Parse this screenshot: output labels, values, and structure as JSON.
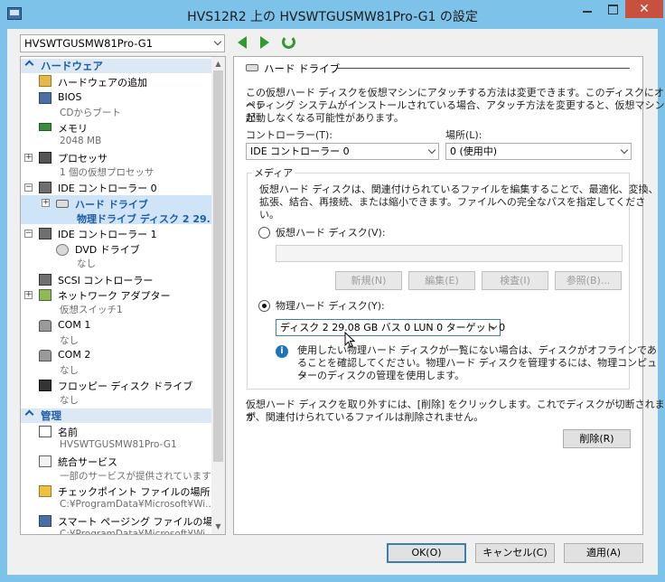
{
  "window": {
    "title": "HVS12R2 上の HVSWTGUSMW81Pro-G1 の設定",
    "close_glyph": "✕"
  },
  "vm_selector": {
    "value": "HVSWTGUSMW81Pro-G1"
  },
  "tree": {
    "hardware_header": "ハードウェア",
    "management_header": "管理",
    "items": {
      "add_hardware": "ハードウェアの追加",
      "bios": {
        "label": "BIOS",
        "sub": "CDからブート"
      },
      "memory": {
        "label": "メモリ",
        "sub": "2048 MB"
      },
      "processor": {
        "label": "プロセッサ",
        "sub": "1 個の仮想プロセッサ"
      },
      "ide0": "IDE コントローラー 0",
      "hard_drive": {
        "label": "ハード ドライブ",
        "sub": "物理ドライブ ディスク 2 29..."
      },
      "ide1": "IDE コントローラー 1",
      "dvd": {
        "label": "DVD ドライブ",
        "sub": "なし"
      },
      "scsi": "SCSI コントローラー",
      "network": {
        "label": "ネットワーク アダプター",
        "sub": "仮想スイッチ1"
      },
      "com1": {
        "label": "COM 1",
        "sub": "なし"
      },
      "com2": {
        "label": "COM 2",
        "sub": "なし"
      },
      "floppy": {
        "label": "フロッピー ディスク ドライブ",
        "sub": "なし"
      },
      "name": {
        "label": "名前",
        "sub": "HVSWTGUSMW81Pro-G1"
      },
      "integration": {
        "label": "統合サービス",
        "sub": "一部のサービスが提供されています"
      },
      "checkpoint": {
        "label": "チェックポイント ファイルの場所",
        "sub": "C:¥ProgramData¥Microsoft¥Wi..."
      },
      "paging": {
        "label": "スマート ページング ファイルの場所",
        "sub": "C:¥ProgramData¥Microsoft¥Wi..."
      }
    }
  },
  "detail": {
    "section_title": "ハード ドライブ",
    "intro_lines": [
      "この仮想ハード ディスクを仮想マシンにアタッチする方法は変更できます。このディスクにオペレ",
      "ーティング システムがインストールされている場合、アタッチ方法を変更すると、仮想マシンが",
      "起動しなくなる可能性があります。"
    ],
    "controller_label": "コントローラー(T):",
    "controller_value": "IDE コントローラー 0",
    "location_label": "場所(L):",
    "location_value": "0 (使用中)",
    "media_label": "メディア",
    "media_desc_lines": [
      "仮想ハード ディスクは、関連付けられているファイルを編集することで、最適化、変換、",
      "拡張、結合、再接続、または縮小できます。ファイルへの完全なパスを指定してくださ",
      "い。"
    ],
    "vhd_radio_label": "仮想ハード ディスク(V):",
    "buttons": {
      "new": "新規(N)",
      "edit": "編集(E)",
      "inspect": "検査(I)",
      "browse": "参照(B)..."
    },
    "physical_radio_label": "物理ハード ディスク(Y):",
    "physical_value": "ディスク 2 29.08 GB バス 0 LUN 0 ターゲット 0",
    "info_lines": [
      "使用したい物理ハード ディスクが一覧にない場合は、ディスクがオフラインであ",
      "ることを確認してください。物理ハード ディスクを管理するには、物理コンピュー",
      "ターのディスクの管理を使用します。"
    ],
    "remove_lines": [
      "仮想ハード ディスクを取り外すには、[削除] をクリックします。これでディスクが切断されます",
      "が、関連付けられているファイルは削除されません。"
    ],
    "remove_button": "削除(R)"
  },
  "footer": {
    "ok": "OK(O)",
    "cancel": "キャンセル(C)",
    "apply": "適用(A)"
  }
}
